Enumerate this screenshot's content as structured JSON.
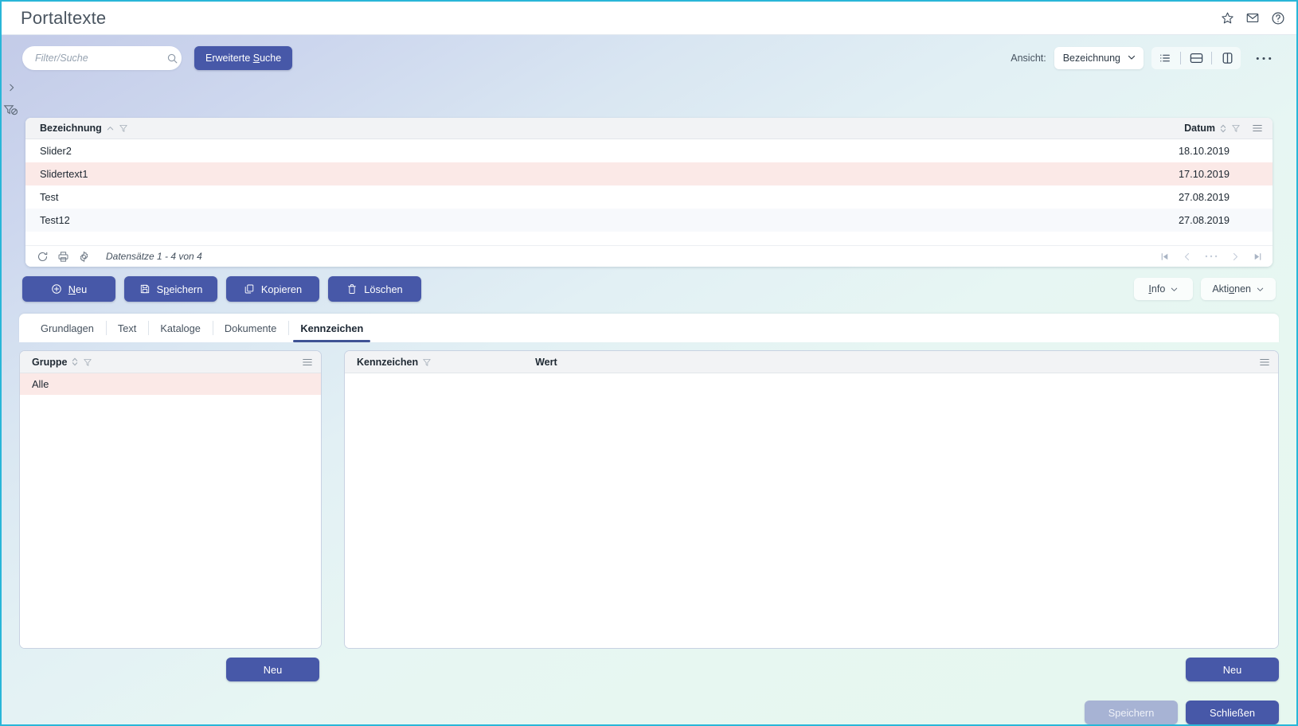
{
  "window": {
    "title": "Portaltexte",
    "titlebar_icons": [
      "star-icon",
      "mail-icon",
      "help-icon"
    ]
  },
  "toolbar": {
    "search_placeholder": "Filter/Suche",
    "search_value": "",
    "advanced_search_label": "Erweiterte Suche",
    "view_label": "Ansicht:",
    "view_selected": "Bezeichnung",
    "view_options": [
      "Bezeichnung"
    ],
    "more_label": "•••"
  },
  "grid": {
    "columns": [
      {
        "label": "Bezeichnung",
        "sort": "asc"
      },
      {
        "label": "Datum",
        "sort": "none"
      }
    ],
    "rows": [
      {
        "bezeichnung": "Slider2",
        "datum": "18.10.2019",
        "state": "normal"
      },
      {
        "bezeichnung": "Slidertext1",
        "datum": "17.10.2019",
        "state": "selected"
      },
      {
        "bezeichnung": "Test",
        "datum": "27.08.2019",
        "state": "normal"
      },
      {
        "bezeichnung": "Test12",
        "datum": "27.08.2019",
        "state": "alt"
      }
    ],
    "footer": {
      "records": "Datensätze 1 - 4 von 4",
      "icons": [
        "refresh-icon",
        "print-icon",
        "settings-icon"
      ],
      "pager": [
        "first-page-icon",
        "previous-page-icon",
        "ellipsis-icon",
        "next-page-icon",
        "last-page-icon"
      ]
    }
  },
  "actions": {
    "new_label": "Neu",
    "save_label": "Speichern",
    "copy_label": "Kopieren",
    "delete_label": "Löschen",
    "info_label": "Info",
    "aktionen_label": "Aktionen"
  },
  "tabs": [
    {
      "label": "Grundlagen",
      "active": false
    },
    {
      "label": "Text",
      "active": false
    },
    {
      "label": "Kataloge",
      "active": false
    },
    {
      "label": "Dokumente",
      "active": false
    },
    {
      "label": "Kennzeichen",
      "active": true
    }
  ],
  "gruppe_panel": {
    "header": "Gruppe",
    "rows": [
      {
        "label": "Alle",
        "state": "selected"
      }
    ],
    "new_label": "Neu"
  },
  "kennzeichen_panel": {
    "header_1": "Kennzeichen",
    "header_2": "Wert",
    "rows": [],
    "new_label": "Neu"
  },
  "footer": {
    "save_label": "Speichern",
    "close_label": "Schließen",
    "save_enabled": false
  },
  "colors": {
    "accent": "#4758a8",
    "window_border": "#29b6d8",
    "selected_row": "#fbe9e7",
    "tab_underline": "#3f5395",
    "disabled": "#a7b3d4"
  }
}
